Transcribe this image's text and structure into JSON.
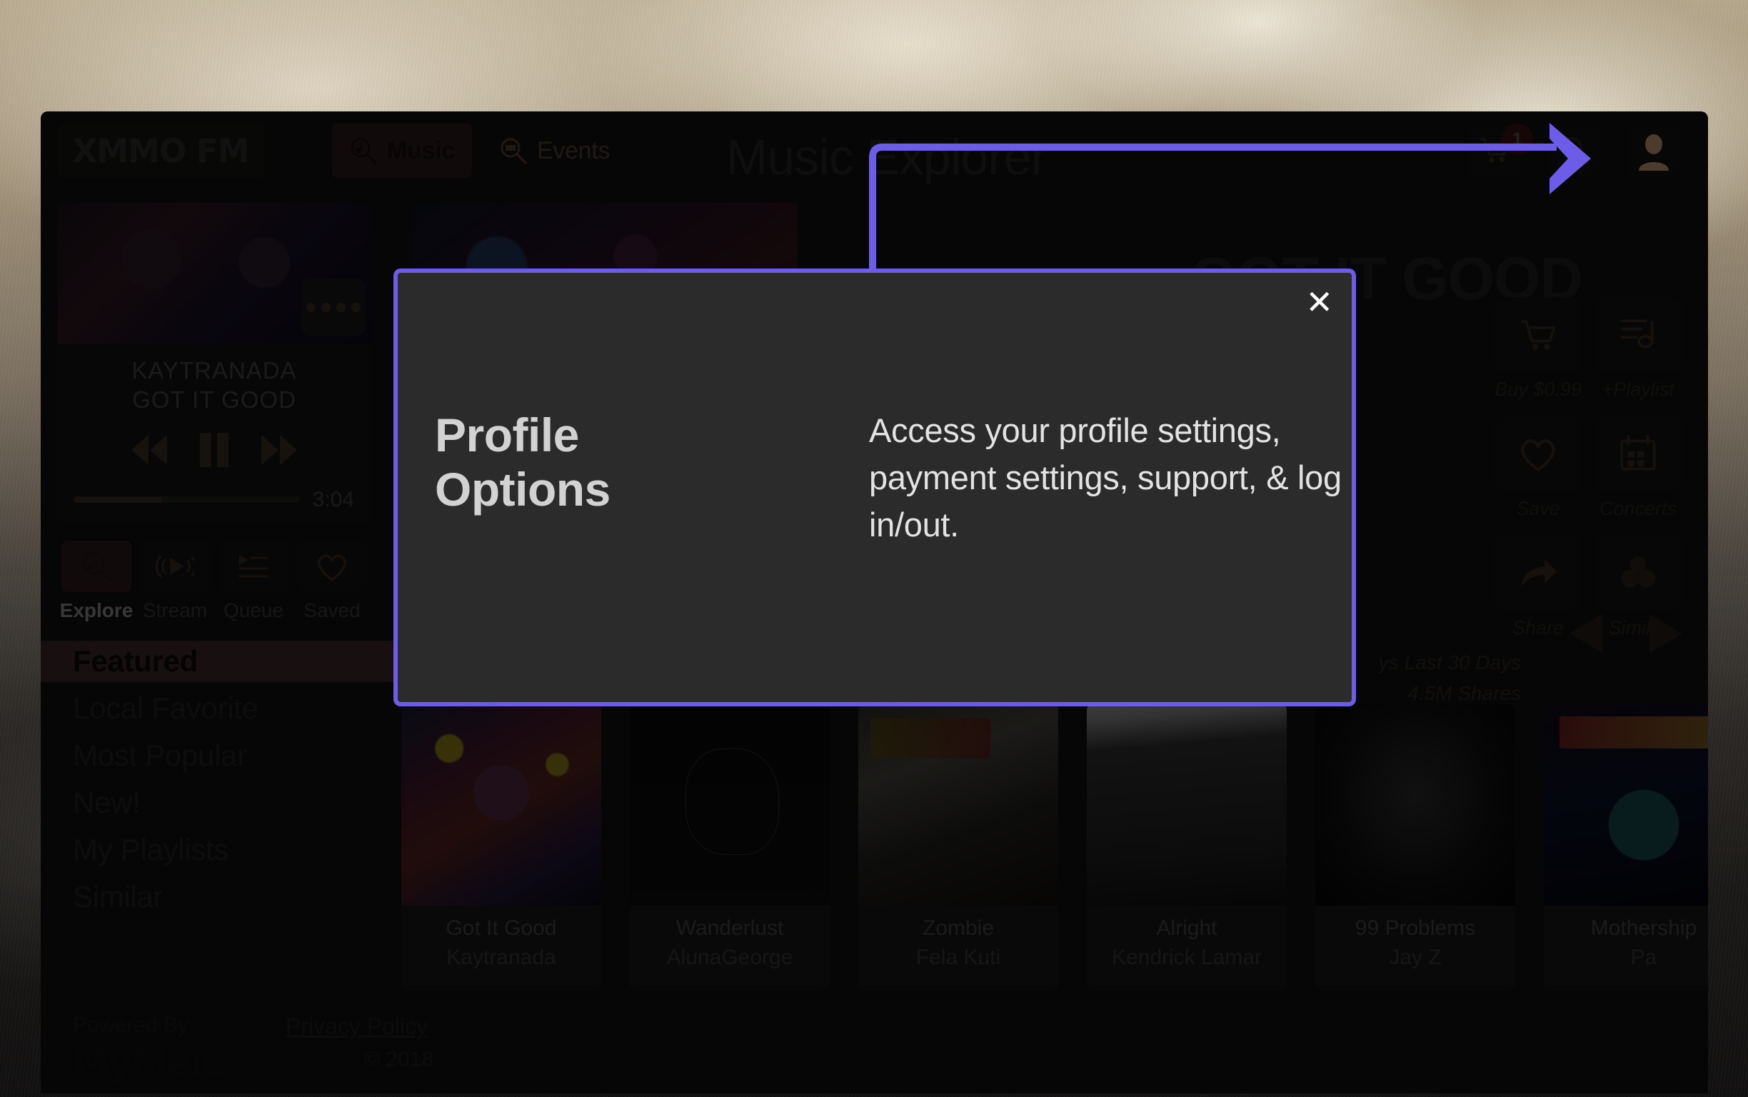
{
  "header": {
    "logo": "XMMO FM",
    "page_title": "Music Explorer",
    "tabs": [
      {
        "label": "Music",
        "icon": "music-search-icon",
        "active": true
      },
      {
        "label": "Events",
        "icon": "ticket-search-icon",
        "active": false
      }
    ],
    "cart_badge": "1",
    "icons": {
      "cart": "cart-icon",
      "search": "search-icon",
      "profile": "profile-avatar-icon"
    }
  },
  "player": {
    "artist": "KAYTRANADA",
    "track": "GOT IT GOOD",
    "time": "3:04",
    "progress_percent": 39,
    "controls": [
      "previous-button",
      "pause-button",
      "next-button"
    ],
    "more_icon": "more-dots-icon"
  },
  "mode_tabs": [
    {
      "label": "Explore",
      "icon": "music-search-icon",
      "active": true
    },
    {
      "label": "Stream",
      "icon": "broadcast-icon",
      "active": false
    },
    {
      "label": "Queue",
      "icon": "queue-icon",
      "active": false
    },
    {
      "label": "Saved",
      "icon": "heart-icon",
      "active": false
    }
  ],
  "categories": [
    {
      "label": "Featured",
      "active": true
    },
    {
      "label": "Local Favorite",
      "active": false
    },
    {
      "label": "Most Popular",
      "active": false
    },
    {
      "label": "New!",
      "active": false
    },
    {
      "label": "My Playlists",
      "active": false
    },
    {
      "label": "Similar",
      "active": false
    }
  ],
  "hero": {
    "title": "GOT IT GOOD",
    "stats": [
      "ys Last 30 Days",
      "4.5M Shares"
    ]
  },
  "actions": [
    {
      "label": "Buy $0.99",
      "icon": "cart-icon"
    },
    {
      "label": "+Playlist",
      "icon": "add-playlist-icon"
    },
    {
      "label": "Save",
      "icon": "heart-icon"
    },
    {
      "label": "Concerts",
      "icon": "calendar-icon"
    },
    {
      "label": "Share",
      "icon": "share-arrow-icon"
    },
    {
      "label": "Similar",
      "icon": "people-icon"
    }
  ],
  "carousel": {
    "prev": "prev-arrow-icon",
    "next": "next-arrow-icon"
  },
  "albums": [
    {
      "title": "Got It Good",
      "artist": "Kaytranada",
      "cover": "cov1"
    },
    {
      "title": "Wanderlust",
      "artist": "AlunaGeorge",
      "cover": "cov2"
    },
    {
      "title": "Zombie",
      "artist": "Fela Kuti",
      "cover": "cov3"
    },
    {
      "title": "Alright",
      "artist": "Kendrick Lamar",
      "cover": "cov4"
    },
    {
      "title": "99 Problems",
      "artist": "Jay Z",
      "cover": "cov5"
    },
    {
      "title": "Mothership",
      "artist": "Pa",
      "cover": "cov6"
    }
  ],
  "footer": {
    "powered_by": "Powered By",
    "brand": "MyMelo",
    "privacy": "Privacy Policy",
    "copyright": "© 2018"
  },
  "modal": {
    "heading": "Profile Options",
    "body": "Access your profile settings, payment settings, support, & log in/out.",
    "close": "✕",
    "accent_color": "#6c5ce7"
  }
}
